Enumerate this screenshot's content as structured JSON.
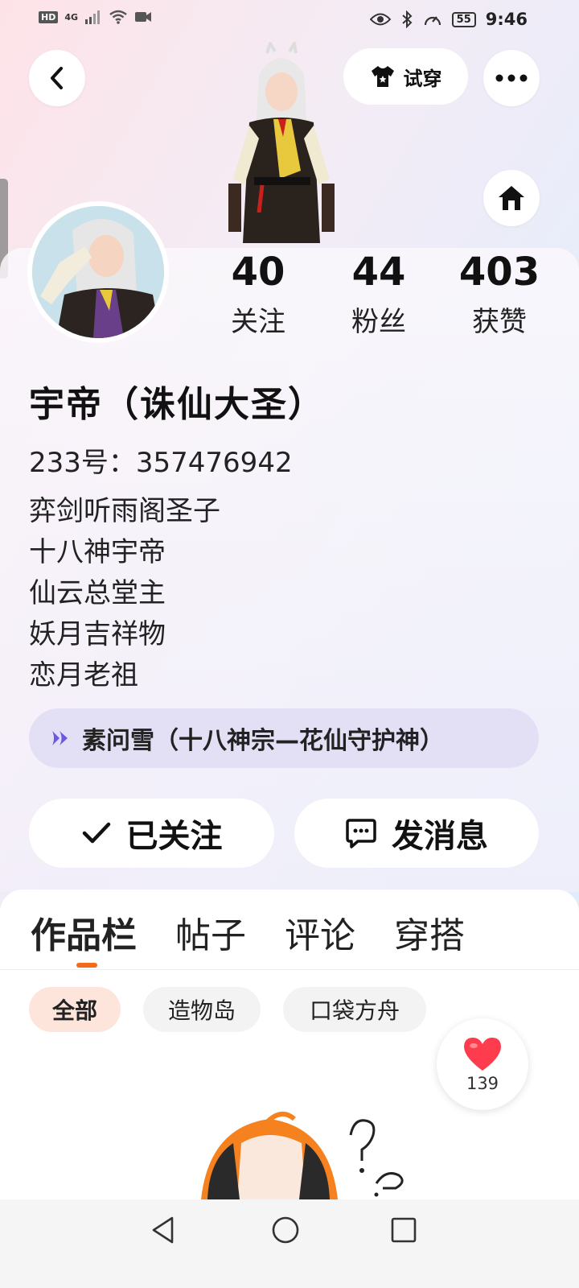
{
  "status_bar": {
    "hd": "HD",
    "network": "4G",
    "battery": "55",
    "time": "9:46"
  },
  "header": {
    "tryon_label": "试穿"
  },
  "profile": {
    "stats": [
      {
        "value": "40",
        "label": "关注"
      },
      {
        "value": "44",
        "label": "粉丝"
      },
      {
        "value": "403",
        "label": "获赞"
      }
    ],
    "username": "宇帝（诛仙大圣）",
    "user_id": "233号：357476942",
    "bio_lines": [
      "弈剑听雨阁圣子",
      "十八神宇帝",
      "仙云总堂主",
      "妖月吉祥物",
      "恋月老祖"
    ],
    "tag_text": "素问雪（十八神宗—花仙守护神）"
  },
  "actions": {
    "follow_label": "已关注",
    "message_label": "发消息"
  },
  "tabs": [
    "作品栏",
    "帖子",
    "评论",
    "穿搭"
  ],
  "filters": [
    "全部",
    "造物岛",
    "口袋方舟"
  ],
  "like_fab": {
    "count": "139"
  },
  "colors": {
    "accent": "#f26b1d",
    "heart": "#ff3b4e"
  }
}
